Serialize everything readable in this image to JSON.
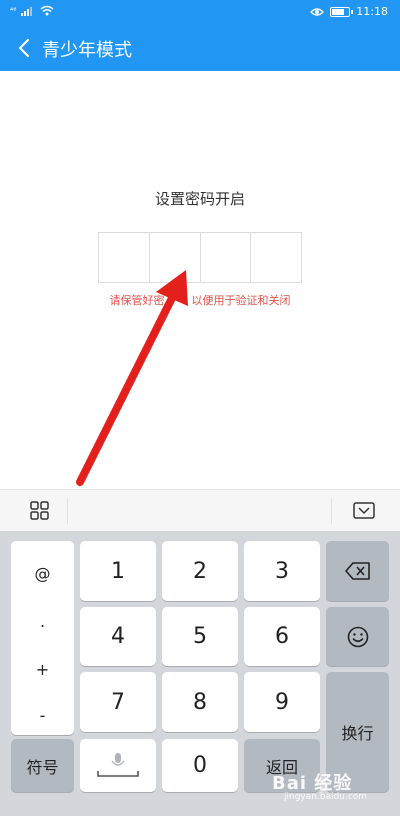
{
  "status_bar": {
    "signal_label": "⁴⁶",
    "time": "11:18",
    "battery_level_percent": 80
  },
  "header": {
    "title": "青少年模式"
  },
  "password": {
    "title": "设置密码开启",
    "hint_part1": "请保管好密",
    "hint_part2": "以便用于验证和关闭",
    "box_count": 4
  },
  "keyboard": {
    "symbols": [
      "@",
      ".",
      "+",
      "-"
    ],
    "digits": [
      "1",
      "2",
      "3",
      "4",
      "5",
      "6",
      "7",
      "8",
      "9",
      "0"
    ],
    "symbol_key": "符号",
    "return_key": "返回",
    "newline_key": "换行"
  },
  "watermark": {
    "text": "Bai 经验",
    "url": "jingyan.baidu.com"
  },
  "colors": {
    "header_bg": "#2196f3",
    "hint_red": "#e0524b",
    "arrow_red": "#e3201b"
  }
}
